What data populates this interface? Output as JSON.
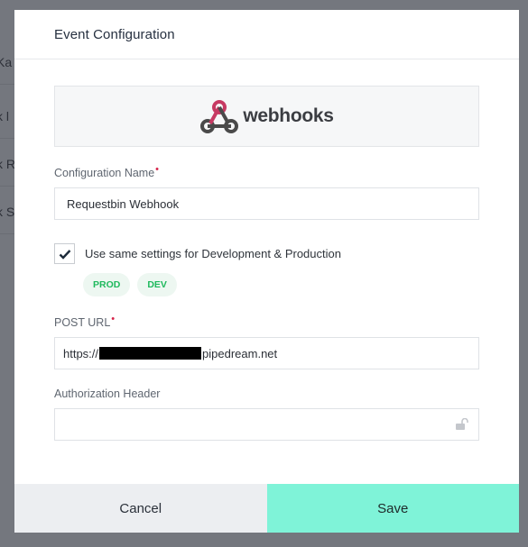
{
  "background": {
    "rows": [
      "Ka",
      "k l",
      "k R",
      "k S"
    ]
  },
  "modal": {
    "title": "Event Configuration",
    "logo": {
      "icon": "webhook-logo-icon",
      "text": "webhooks"
    },
    "config_name": {
      "label": "Configuration Name",
      "value": "Requestbin Webhook"
    },
    "same_settings": {
      "label": "Use same settings for Development & Production",
      "checked": true
    },
    "env_tags": [
      "PROD",
      "DEV"
    ],
    "post_url": {
      "label": "POST URL",
      "prefix": "https://",
      "suffix": "pipedream.net"
    },
    "auth_header": {
      "label": "Authorization Header",
      "value": "",
      "icon": "lock-icon"
    },
    "required_marker": "•"
  },
  "footer": {
    "cancel_label": "Cancel",
    "save_label": "Save"
  },
  "colors": {
    "save_bg": "#7ff3d8",
    "required": "#d6244a",
    "tag_text": "#1fb95d"
  }
}
